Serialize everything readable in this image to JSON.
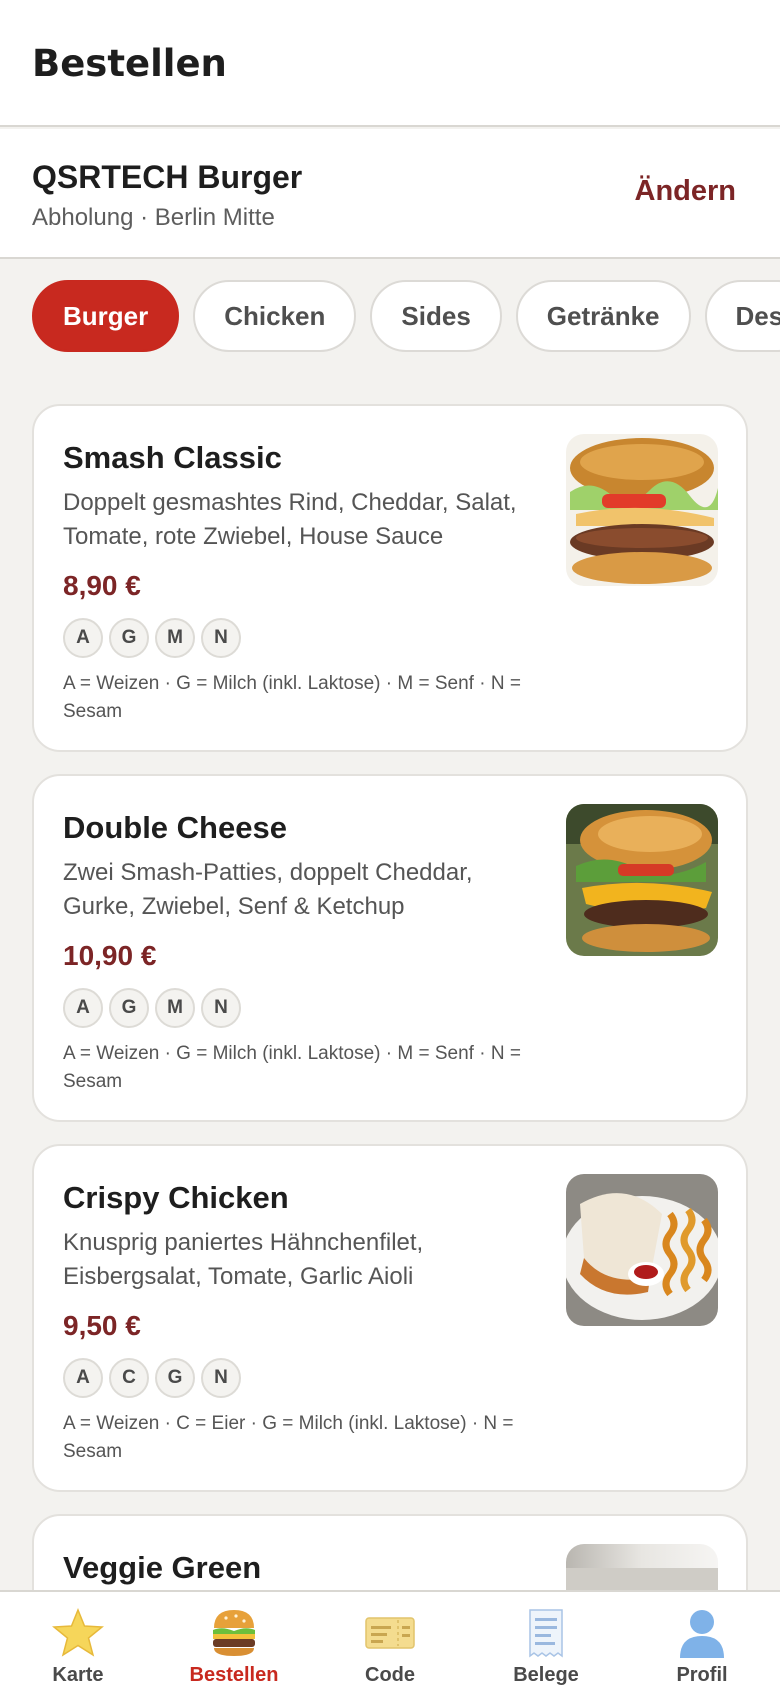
{
  "header": {
    "title": "Bestellen"
  },
  "store": {
    "name": "QSRTECH Burger",
    "subtitle": "Abholung · Berlin Mitte",
    "change_label": "Ändern"
  },
  "categories": [
    {
      "label": "Burger",
      "active": true
    },
    {
      "label": "Chicken",
      "active": false
    },
    {
      "label": "Sides",
      "active": false
    },
    {
      "label": "Getränke",
      "active": false
    },
    {
      "label": "Des",
      "active": false
    }
  ],
  "products": [
    {
      "name": "Smash Classic",
      "description": "Doppelt gesmashtes Rind, Cheddar, Salat, Tomate, rote Zwiebel, House Sauce",
      "price": "8,90 €",
      "allergens": [
        "A",
        "G",
        "M",
        "N"
      ],
      "allergen_legend": "A = Weizen · G = Milch (inkl. Laktose) · M = Senf · N = Sesam",
      "image": "burger-photo"
    },
    {
      "name": "Double Cheese",
      "description": "Zwei Smash-Patties, doppelt Cheddar, Gurke, Zwiebel, Senf & Ketchup",
      "price": "10,90 €",
      "allergens": [
        "A",
        "G",
        "M",
        "N"
      ],
      "allergen_legend": "A = Weizen · G = Milch (inkl. Laktose) · M = Senf · N = Sesam",
      "image": "cheeseburger-photo"
    },
    {
      "name": "Crispy Chicken",
      "description": "Knusprig paniertes Hähnchenfilet, Eisbergsalat, Tomate, Garlic Aioli",
      "price": "9,50 €",
      "allergens": [
        "A",
        "C",
        "G",
        "N"
      ],
      "allergen_legend": "A = Weizen · C = Eier · G = Milch (inkl. Laktose) · N = Sesam",
      "image": "chicken-sandwich-photo"
    },
    {
      "name": "Veggie Green",
      "image": "veggie-burger-photo"
    }
  ],
  "nav": [
    {
      "label": "Karte",
      "icon": "star-icon"
    },
    {
      "label": "Bestellen",
      "icon": "burger-icon",
      "active": true
    },
    {
      "label": "Code",
      "icon": "ticket-icon"
    },
    {
      "label": "Belege",
      "icon": "receipt-icon"
    },
    {
      "label": "Profil",
      "icon": "person-icon"
    }
  ],
  "colors": {
    "accent": "#c8291f",
    "price": "#7c2526",
    "background": "#f3f2ef"
  }
}
